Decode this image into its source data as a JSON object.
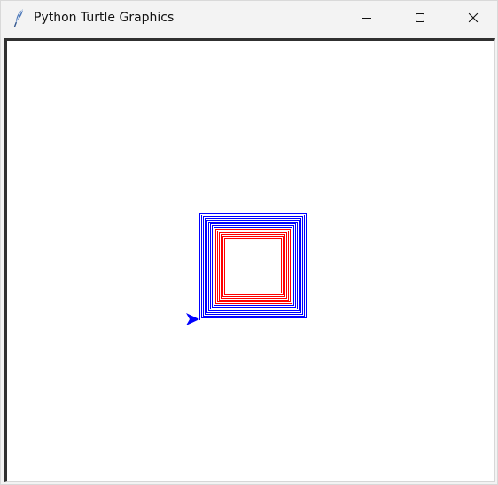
{
  "window": {
    "title": "Python Turtle Graphics"
  },
  "icons": {
    "app": "feather-icon",
    "minimize": "minimize-icon",
    "maximize": "maximize-icon",
    "close": "close-icon",
    "turtle": "turtle-arrow-icon"
  },
  "canvas": {
    "background": "#ffffff",
    "drawing": {
      "shape": "square-spiral",
      "outer_color": "#0000ff",
      "inner_color": "#ff0000",
      "pen_color": "#0000ff"
    }
  }
}
